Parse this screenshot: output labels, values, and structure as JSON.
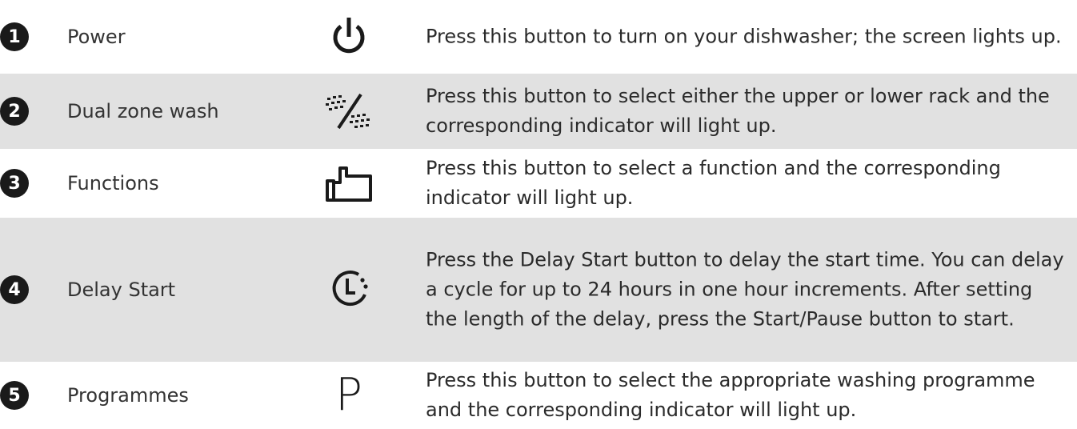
{
  "rows": [
    {
      "number": "1",
      "name": "Power",
      "icon": "power-icon",
      "description": "Press this button to turn on your dishwasher; the screen lights up."
    },
    {
      "number": "2",
      "name": "Dual zone wash",
      "icon": "dual-zone-spray-icon",
      "description": "Press this button to select either the upper or lower rack and the corresponding indicator will light up."
    },
    {
      "number": "3",
      "name": "Functions",
      "icon": "hand-button-icon",
      "description": "Press this button to select a function and the corresponding indicator will light up."
    },
    {
      "number": "4",
      "name": "Delay Start",
      "icon": "delay-clock-icon",
      "description": "Press the Delay Start button to delay the start time. You can delay a cycle for up to 24 hours in one hour increments. After setting the length of the delay, press the Start/Pause button to start."
    },
    {
      "number": "5",
      "name": "Programmes",
      "icon": "programmes-p-icon",
      "icon_glyph": "P",
      "description": "Press this button to select the appropriate washing programme and the corresponding indicator will light up."
    }
  ],
  "colors": {
    "shade": "#e1e1e1",
    "badge": "#1a1a1a",
    "text": "#2b2b2b"
  }
}
